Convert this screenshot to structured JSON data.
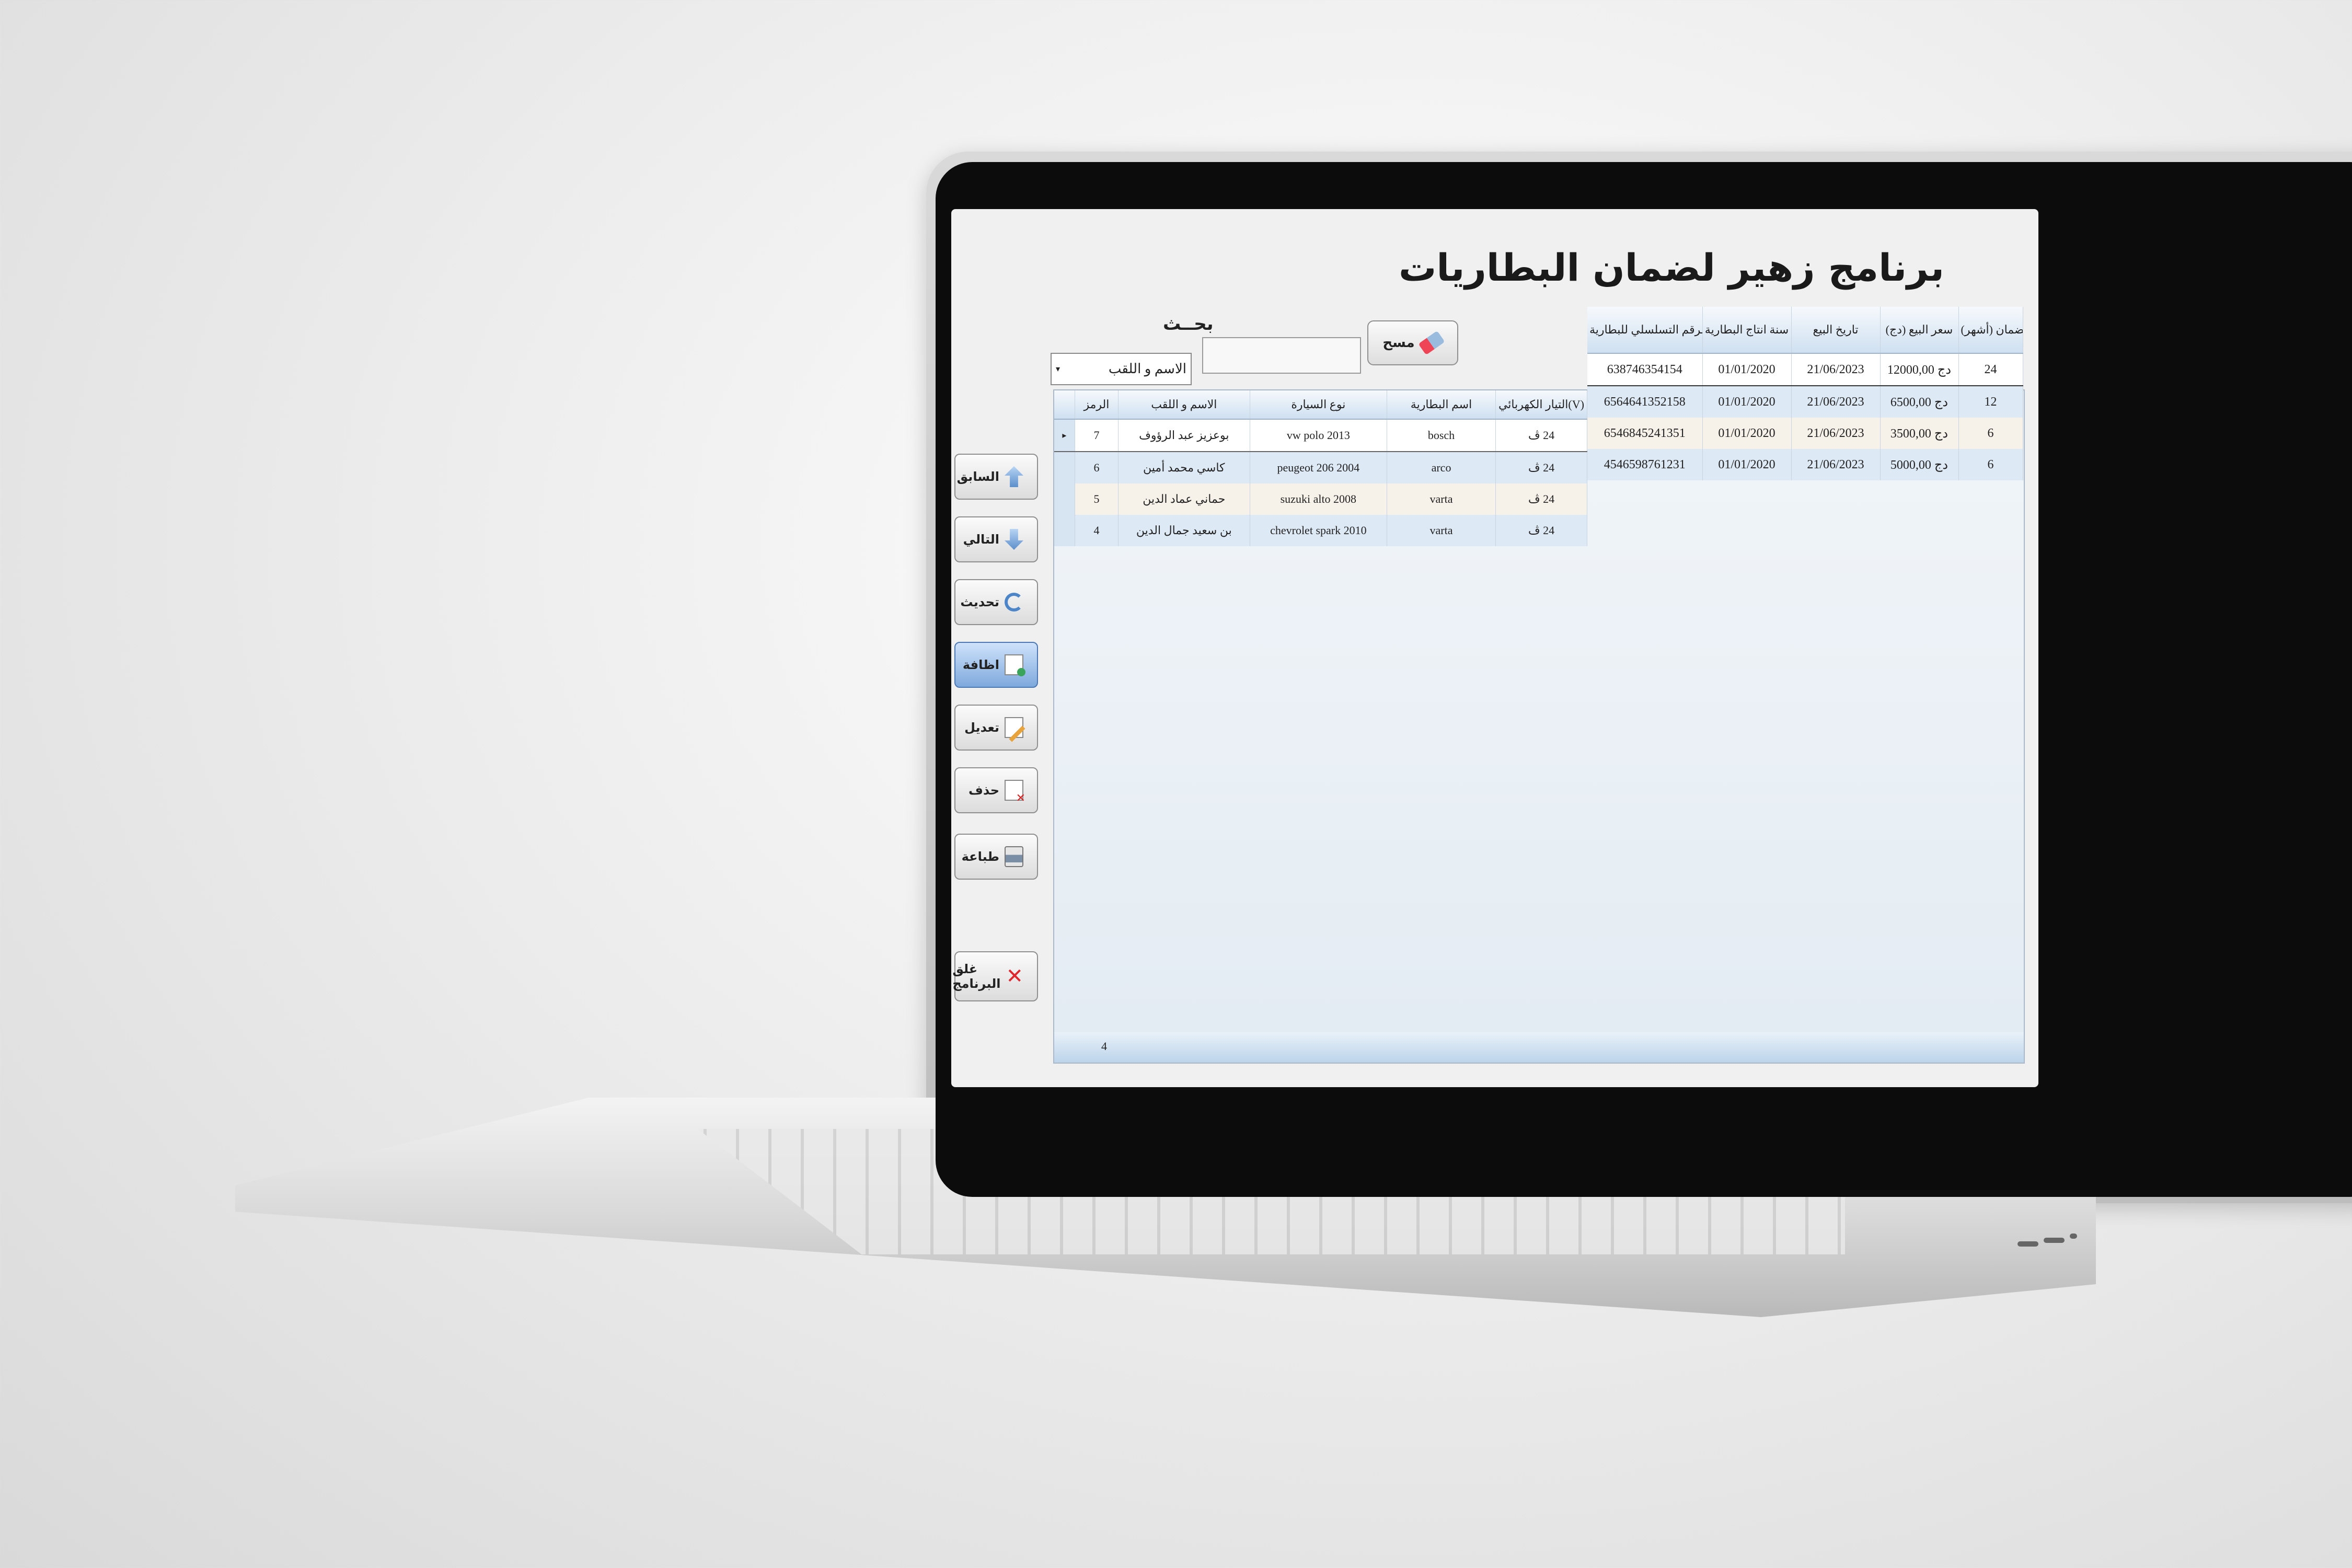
{
  "app": {
    "title": "برنامج زهير لضمان البطاريات",
    "search_label": "بحــث",
    "clear_button": "مسح",
    "search_input_value": "",
    "search_field_selected": "الاسم و اللقب"
  },
  "sidebar": {
    "items": [
      {
        "label": "السابق",
        "icon": "arrow-up-icon"
      },
      {
        "label": "التالي",
        "icon": "arrow-down-icon"
      },
      {
        "label": "تحديث",
        "icon": "refresh-icon"
      },
      {
        "label": "اظافة",
        "icon": "add-document-icon"
      },
      {
        "label": "تعديل",
        "icon": "edit-document-icon"
      },
      {
        "label": "حذف",
        "icon": "delete-document-icon"
      },
      {
        "label": "طباعة",
        "icon": "printer-icon"
      },
      {
        "label": "غلق البرنامج",
        "icon": "close-icon"
      }
    ]
  },
  "grid": {
    "columns_left": [
      "الرمز",
      "الاسم و اللقب",
      "نوع السيارة",
      "اسم البطارية",
      "التيار الكهربائي(V)"
    ],
    "rows_left": [
      {
        "code": "7",
        "name": "بوعزيز عبد الرؤوف",
        "car": "vw polo 2013",
        "battery": "bosch",
        "voltage": "24 ڤ"
      },
      {
        "code": "6",
        "name": "كاسي محمد أمين",
        "car": "peugeot 206 2004",
        "battery": "arco",
        "voltage": "24 ڤ"
      },
      {
        "code": "5",
        "name": "حماني عماد الدين",
        "car": "suzuki alto 2008",
        "battery": "varta",
        "voltage": "24 ڤ"
      },
      {
        "code": "4",
        "name": "بن سعيد جمال الدين",
        "car": "chevrolet spark 2010",
        "battery": "varta",
        "voltage": "24 ڤ"
      }
    ],
    "columns_right": [
      "الرقم التسلسلي للبطارية",
      "سنة انتاج البطارية",
      "تاريخ البيع",
      "سعر البيع (دج)",
      "مدة الضمان (أشهر)"
    ],
    "rows_right": [
      {
        "serial": "638746354154",
        "year": "01/01/2020",
        "sale_date": "21/06/2023",
        "price": "دج 12000,00",
        "warranty": "24"
      },
      {
        "serial": "6564641352158",
        "year": "01/01/2020",
        "sale_date": "21/06/2023",
        "price": "دج 6500,00",
        "warranty": "12"
      },
      {
        "serial": "6546845241351",
        "year": "01/01/2020",
        "sale_date": "21/06/2023",
        "price": "دج 3500,00",
        "warranty": "6"
      },
      {
        "serial": "4546598761231",
        "year": "01/01/2020",
        "sale_date": "21/06/2023",
        "price": "دج 5000,00",
        "warranty": "6"
      }
    ],
    "row_count": "4"
  },
  "colors": {
    "row_odd": "#f7f2e9",
    "row_even": "#dde9f5",
    "active_button": "#7ea9dc",
    "close_icon": "#e1262b"
  }
}
